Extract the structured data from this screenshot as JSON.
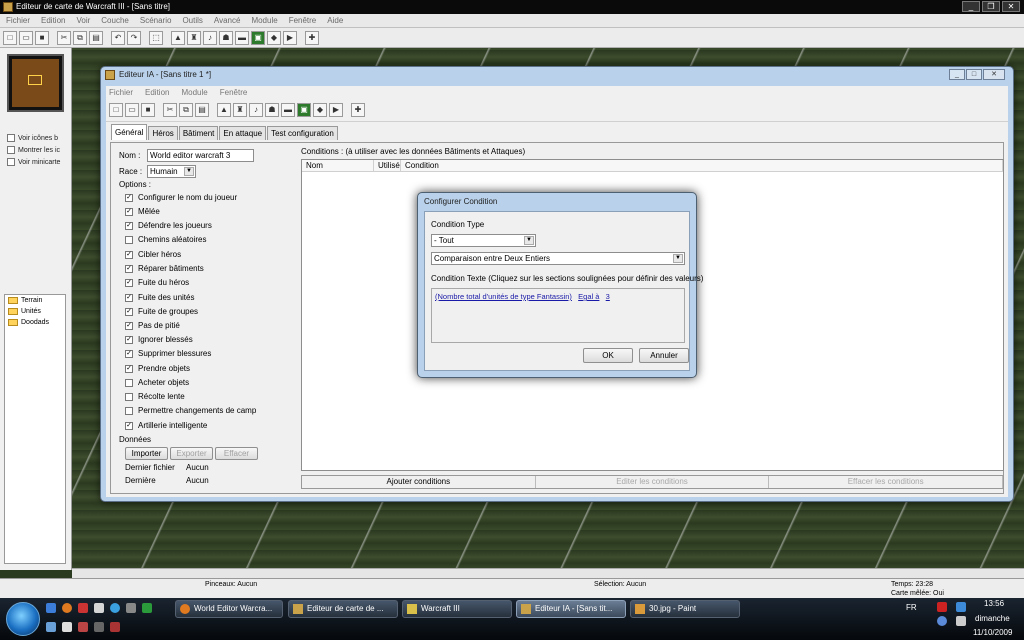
{
  "main_window": {
    "title": "Editeur de carte de Warcraft III - [Sans titre]",
    "menu": [
      "Fichier",
      "Edition",
      "Voir",
      "Couche",
      "Scénario",
      "Outils",
      "Avancé",
      "Module",
      "Fenêtre",
      "Aide"
    ]
  },
  "left_panel": {
    "checkboxes": [
      {
        "label": "Voir icônes b",
        "checked": false
      },
      {
        "label": "Montrer les ic",
        "checked": false
      },
      {
        "label": "Voir minicarte",
        "checked": false
      }
    ],
    "tree": [
      "Terrain",
      "Unités",
      "Doodads"
    ]
  },
  "status_bar": {
    "brushes": "Pinceaux: Aucun",
    "selection": "Sélection: Aucun",
    "time": "Temps: 23:28",
    "melee": "Carte mêlée: Oui"
  },
  "ai_editor": {
    "title": "Editeur IA - [Sans titre 1 *]",
    "menu": [
      "Fichier",
      "Edition",
      "Module",
      "Fenêtre"
    ],
    "tabs": [
      "Général",
      "Héros",
      "Bâtiment",
      "En attaque",
      "Test configuration"
    ],
    "general": {
      "name_label": "Nom :",
      "name_value": "World editor warcraft 3",
      "race_label": "Race :",
      "race_value": "Humain",
      "options_label": "Options :",
      "options": [
        {
          "label": "Configurer le nom du joueur",
          "checked": true
        },
        {
          "label": "Mêlée",
          "checked": true
        },
        {
          "label": "Défendre les joueurs",
          "checked": true
        },
        {
          "label": "Chemins aléatoires",
          "checked": false
        },
        {
          "label": "Cibler héros",
          "checked": true
        },
        {
          "label": "Réparer bâtiments",
          "checked": true
        },
        {
          "label": "Fuite du héros",
          "checked": true
        },
        {
          "label": "Fuite des unités",
          "checked": true
        },
        {
          "label": "Fuite de groupes",
          "checked": true
        },
        {
          "label": "Pas de pitié",
          "checked": true
        },
        {
          "label": "Ignorer blessés",
          "checked": true
        },
        {
          "label": "Supprimer blessures",
          "checked": true
        },
        {
          "label": "Prendre objets",
          "checked": true
        },
        {
          "label": "Acheter objets",
          "checked": false
        },
        {
          "label": "Récolte lente",
          "checked": false
        },
        {
          "label": "Permettre changements de camp",
          "checked": false
        },
        {
          "label": "Artillerie intelligente",
          "checked": true
        }
      ],
      "data_label": "Données",
      "import_btn": "Importer",
      "export_btn": "Exporter",
      "clear_btn": "Effacer",
      "last_file_label": "Dernier fichier",
      "last_file_value": "Aucun",
      "last_label": "Dernière",
      "last_value": "Aucun"
    },
    "conditions": {
      "label": "Conditions : (à utiliser avec les données Bâtiments et Attaques)",
      "columns": [
        "Nom",
        "Utilisé",
        "Condition"
      ],
      "add_btn": "Ajouter conditions",
      "edit_btn": "Editer les conditions",
      "delete_btn": "Effacer les conditions"
    }
  },
  "dialog": {
    "title": "Configurer Condition",
    "type_label": "Condition Type",
    "type_value": "- Tout",
    "comparison_value": "Comparaison entre Deux Entiers",
    "text_label": "Condition Texte (Cliquez sur les sections soulignées pour définir des valeurs)",
    "text_part1": "(Nombre total d'unités de type  Fantassin)",
    "text_part2": "Egal à",
    "text_part3": "3",
    "ok": "OK",
    "cancel": "Annuler"
  },
  "taskbar": {
    "tasks": [
      "World Editor Warcra...",
      "Editeur de carte de ...",
      "Warcraft III",
      "Editeur IA - [Sans tit...",
      "30.jpg - Paint"
    ],
    "lang": "FR",
    "clock": "13:56",
    "day": "dimanche",
    "date": "11/10/2009"
  }
}
